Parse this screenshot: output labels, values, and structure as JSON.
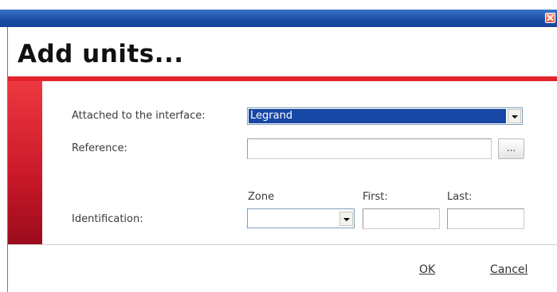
{
  "window": {
    "title": "",
    "close_icon": "close-icon"
  },
  "header": {
    "title": "Add units..."
  },
  "colors": {
    "titlebar": "#1c4fa9",
    "accent": "#e3232e",
    "selection": "#1848a6"
  },
  "form": {
    "interface": {
      "label": "Attached to the interface:",
      "value": "Legrand"
    },
    "reference": {
      "label": "Reference:",
      "value": "",
      "browse_label": "..."
    },
    "identification": {
      "label": "Identification:",
      "zone_label": "Zone",
      "first_label": "First:",
      "last_label": "Last:",
      "zone_value": "",
      "first_value": "",
      "last_value": ""
    }
  },
  "footer": {
    "ok_label": "OK",
    "cancel_label": "Cancel"
  }
}
